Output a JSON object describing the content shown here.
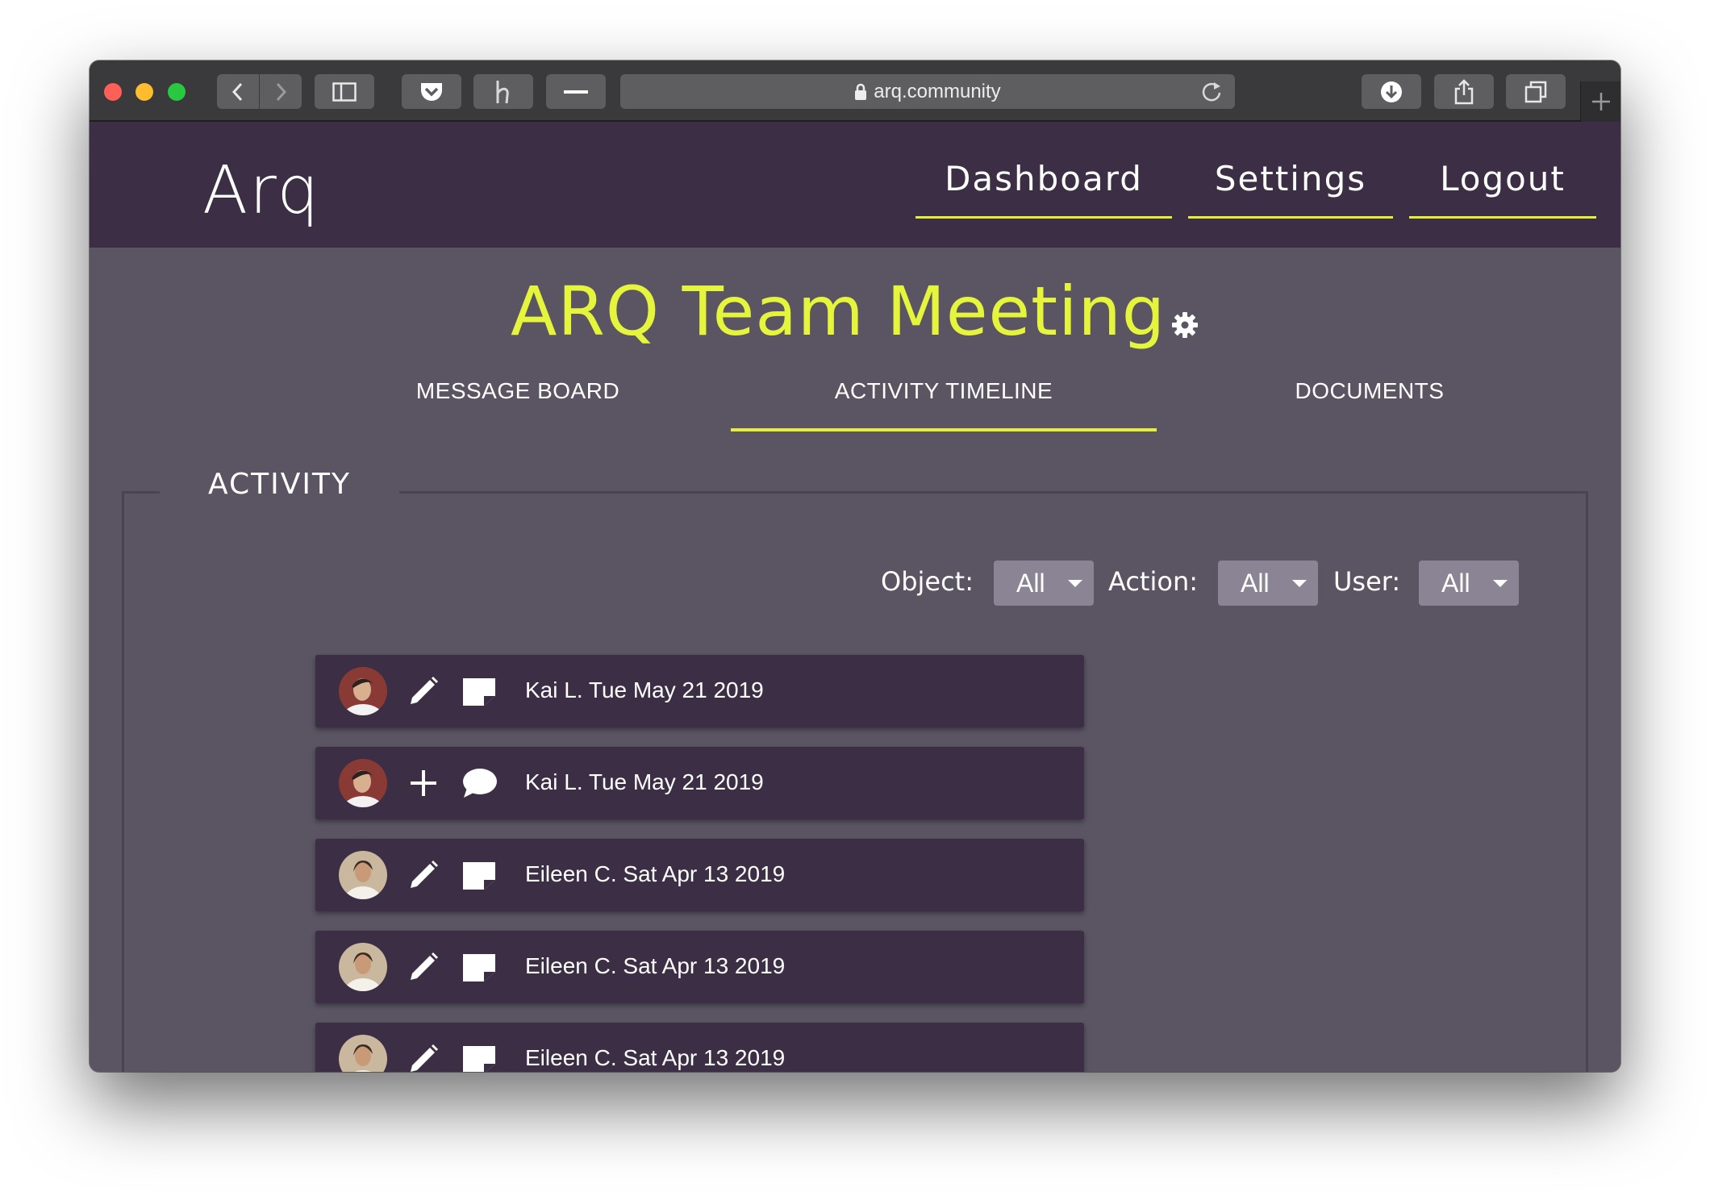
{
  "browser": {
    "url": "arq.community",
    "icons": [
      "back-icon",
      "forward-icon",
      "sidebar-icon",
      "pocket-icon",
      "honey-icon",
      "minus-icon",
      "lock-icon",
      "reload-icon",
      "download-icon",
      "share-icon",
      "tabs-icon",
      "plus-icon"
    ]
  },
  "header": {
    "logo": "Arq",
    "nav": [
      "Dashboard",
      "Settings",
      "Logout"
    ]
  },
  "page": {
    "title": "ARQ Team Meeting",
    "tabs": [
      "MESSAGE BOARD",
      "ACTIVITY TIMELINE",
      "DOCUMENTS"
    ],
    "active_tab": "ACTIVITY TIMELINE"
  },
  "activity": {
    "legend": "ACTIVITY",
    "filters": {
      "object_label": "Object:",
      "object_value": "All",
      "action_label": "Action:",
      "action_value": "All",
      "user_label": "User:",
      "user_value": "All"
    },
    "items": [
      {
        "text": "Kai L. Tue May 21 2019",
        "action_icon": "pencil-icon",
        "object_icon": "note-icon"
      },
      {
        "text": "Kai L. Tue May 21 2019",
        "action_icon": "plus-icon",
        "object_icon": "comment-icon"
      },
      {
        "text": "Eileen C. Sat Apr 13 2019",
        "action_icon": "pencil-icon",
        "object_icon": "note-icon"
      },
      {
        "text": "Eileen C. Sat Apr 13 2019",
        "action_icon": "pencil-icon",
        "object_icon": "note-icon"
      },
      {
        "text": "Eileen C. Sat Apr 13 2019",
        "action_icon": "pencil-icon",
        "object_icon": "note-icon"
      }
    ]
  },
  "colors": {
    "accent": "#e6f032",
    "header_bg": "#3c2f45",
    "content_bg": "#5a5463",
    "item_bg": "#3c2f45"
  }
}
